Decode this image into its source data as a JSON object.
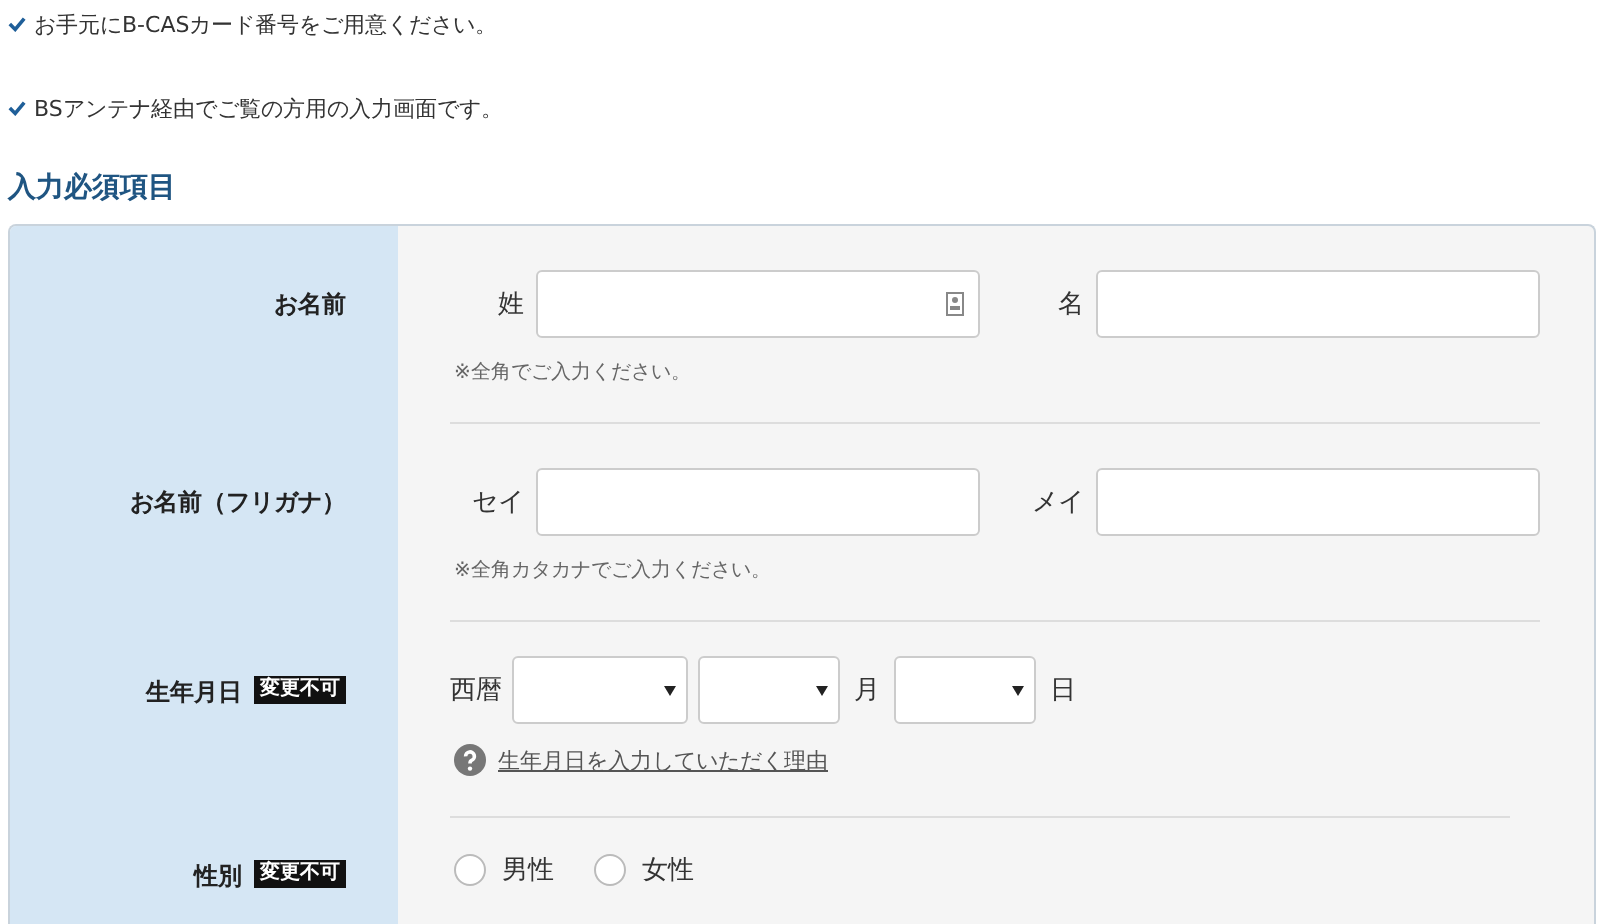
{
  "notes": [
    "お手元にB-CASカード番号をご用意ください。",
    "BSアンテナ経由でご覧の方用の入力画面です。"
  ],
  "section_title": "入力必須項目",
  "rows": [
    {
      "kind": "name",
      "label": "お名前",
      "fields": [
        {
          "label": "姓",
          "autofill": true
        },
        {
          "label": "名"
        }
      ],
      "hint": "※全角でご入力ください。"
    },
    {
      "kind": "name",
      "label": "お名前（フリガナ）",
      "fields": [
        {
          "label": "セイ"
        },
        {
          "label": "メイ"
        }
      ],
      "hint": "※全角カタカナでご入力ください。"
    },
    {
      "kind": "date",
      "label": "生年月日",
      "badge": "変更不可",
      "prefix": "西暦",
      "selects": [
        {
          "kind": "year"
        },
        {
          "kind": "month",
          "suffix": "月"
        },
        {
          "kind": "day",
          "suffix": "日"
        }
      ],
      "help_link": "生年月日を入力していただく理由"
    },
    {
      "kind": "radio",
      "label": "性別",
      "badge": "変更不可",
      "options": [
        {
          "label": "男性",
          "selected": false
        },
        {
          "label": "女性",
          "selected": false
        }
      ]
    }
  ]
}
